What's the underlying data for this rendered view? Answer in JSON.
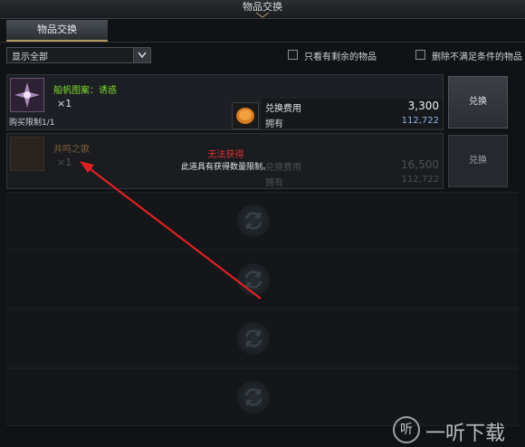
{
  "window": {
    "title": "物品交换"
  },
  "tabs": [
    {
      "label": "物品交换",
      "active": true
    }
  ],
  "filter": {
    "dropdown_value": "显示全部"
  },
  "checkboxes": [
    {
      "label": "只看有剩余的物品",
      "checked": false
    },
    {
      "label": "删除不满足条件的物品",
      "checked": false
    }
  ],
  "items": [
    {
      "name": "船帆图案：诱惑",
      "quantity": "×1",
      "limit": "购买限制1/1",
      "cost_label": "兑换费用",
      "cost_value": "3,300",
      "owned_label": "拥有",
      "owned_value": "112,722",
      "button": "兑换",
      "available": true
    },
    {
      "name": "共鸣之歌",
      "quantity": "×1",
      "cost_label": "兑换费用",
      "cost_value": "16,500",
      "owned_label": "拥有",
      "owned_value": "112,722",
      "button": "兑换",
      "available": false,
      "unavailable_title": "无法获得",
      "unavailable_desc": "此道具有获得数量限制。"
    }
  ],
  "watermark": {
    "logo": "听",
    "text": "一听下载"
  },
  "colors": {
    "accent_green": "#7ddc2a",
    "warning_red": "#e33030",
    "owned_blue": "#8fb5e8",
    "tab_gold": "#b49a62"
  }
}
